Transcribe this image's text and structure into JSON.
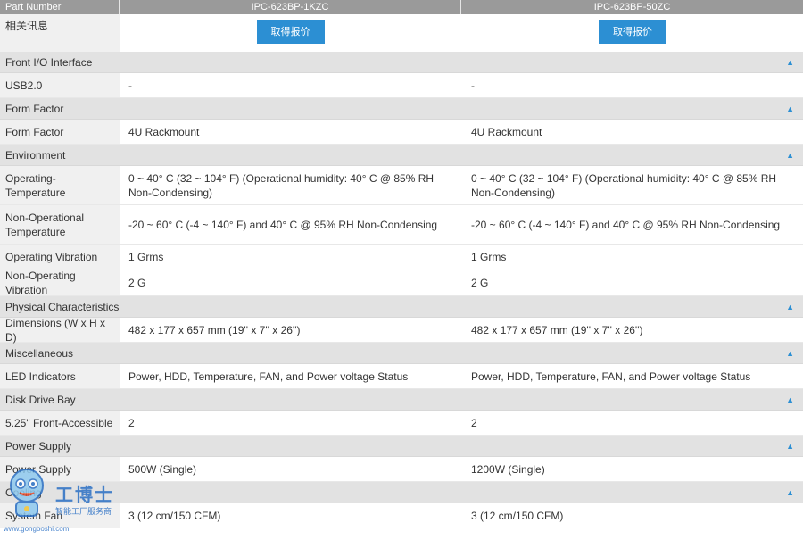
{
  "header": {
    "part_number_label": "Part Number",
    "models": [
      "IPC-623BP-1KZC",
      "IPC-623BP-50ZC"
    ]
  },
  "info": {
    "label": "相关讯息",
    "button_label": "取得报价"
  },
  "sections": {
    "front_io": {
      "title": "Front I/O Interface",
      "rows": [
        {
          "label": "USB2.0",
          "values": [
            "-",
            "-"
          ]
        }
      ]
    },
    "form_factor": {
      "title": "Form Factor",
      "rows": [
        {
          "label": "Form Factor",
          "values": [
            "4U Rackmount",
            "4U Rackmount"
          ]
        }
      ]
    },
    "environment": {
      "title": "Environment",
      "rows": [
        {
          "label": "Operating-Temperature",
          "values": [
            "0 ~ 40° C (32 ~ 104° F) (Operational humidity: 40° C @ 85% RH Non-Condensing)",
            "0 ~ 40° C (32 ~ 104° F) (Operational humidity: 40° C @ 85% RH Non-Condensing)"
          ]
        },
        {
          "label": "Non-Operational Temperature",
          "values": [
            "-20 ~ 60° C (-4 ~ 140° F) and 40° C @ 95% RH Non-Condensing",
            "-20 ~ 60° C (-4 ~ 140° F) and 40° C @ 95% RH Non-Condensing"
          ]
        },
        {
          "label": "Operating Vibration",
          "values": [
            "1 Grms",
            "1 Grms"
          ]
        },
        {
          "label": "Non-Operating Vibration",
          "values": [
            "2 G",
            "2 G"
          ]
        }
      ]
    },
    "physical": {
      "title": "Physical Characteristics",
      "rows": [
        {
          "label": "Dimensions (W x H x D)",
          "values": [
            "482 x 177 x 657 mm (19'' x 7'' x 26'')",
            "482 x 177 x 657 mm (19'' x 7'' x 26'')"
          ]
        }
      ]
    },
    "misc": {
      "title": "Miscellaneous",
      "rows": [
        {
          "label": "LED Indicators",
          "values": [
            "Power, HDD, Temperature, FAN, and Power voltage Status",
            "Power, HDD, Temperature, FAN, and Power voltage Status"
          ]
        }
      ]
    },
    "disk": {
      "title": "Disk Drive Bay",
      "rows": [
        {
          "label": "5.25\" Front-Accessible",
          "values": [
            "2",
            "2"
          ]
        }
      ]
    },
    "power": {
      "title": "Power Supply",
      "rows": [
        {
          "label": "Power Supply",
          "values": [
            "500W (Single)",
            "1200W (Single)"
          ]
        }
      ]
    },
    "cooling": {
      "title": "Cooling",
      "rows": [
        {
          "label": "System Fan",
          "values": [
            "3 (12 cm/150 CFM)",
            "3 (12 cm/150 CFM)"
          ]
        }
      ]
    }
  },
  "chevron_icon": "chevron-up-icon",
  "watermark": {
    "brand": "工博士",
    "subtitle": "智能工厂服务商",
    "url": "www.gongboshi.com"
  },
  "colors": {
    "accent": "#2c8fd3",
    "header_bg": "#9a9a9a",
    "section_bg": "#e2e2e2",
    "label_bg": "#f0f0f0"
  }
}
